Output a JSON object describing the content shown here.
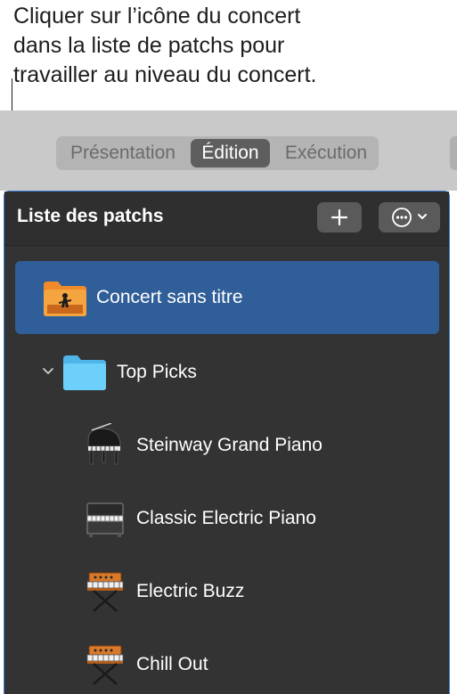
{
  "callout": {
    "lines": [
      "Cliquer sur l’icône du concert",
      "dans la liste de patchs pour",
      "travailler au niveau du concert."
    ]
  },
  "toolbar": {
    "tabs": [
      "Présentation",
      "Édition",
      "Exécution"
    ],
    "active_tab": "Édition"
  },
  "patch_list": {
    "title": "Liste des patchs",
    "add_label": "+",
    "concert": {
      "name": "Concert sans titre",
      "icon": "concert-folder-icon"
    },
    "folder": {
      "name": "Top Picks",
      "icon": "folder-icon",
      "expanded": true
    },
    "patches": [
      {
        "name": "Steinway Grand Piano",
        "icon": "grand-piano-icon"
      },
      {
        "name": "Classic Electric Piano",
        "icon": "electric-piano-icon"
      },
      {
        "name": "Electric Buzz",
        "icon": "synth-keyboard-icon"
      },
      {
        "name": "Chill Out",
        "icon": "synth-keyboard-icon"
      }
    ]
  },
  "colors": {
    "selection": "#2f5e98",
    "panel_bg": "#333333",
    "folder_blue": "#5ec4f5",
    "concert_orange": "#f08a2a",
    "focus_ring": "#3a7bd5"
  }
}
